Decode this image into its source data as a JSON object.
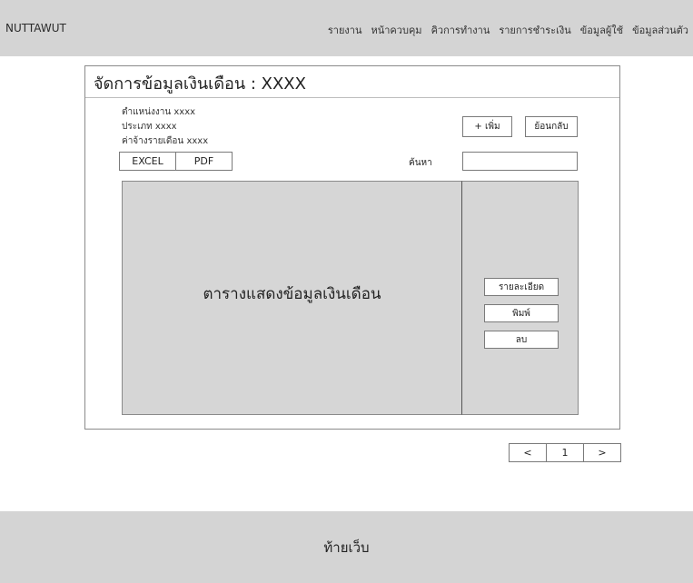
{
  "header": {
    "brand": "NUTTAWUT",
    "nav": [
      "รายงาน",
      "หน้าควบคุม",
      "คิวการทำงาน",
      "รายการชำระเงิน",
      "ข้อมูลผู้ใช้",
      "ข้อมูลส่วนตัว"
    ]
  },
  "panel": {
    "title": "จัดการข้อมูลเงินเดือน : XXXX",
    "info": {
      "position": "ตำแหน่งงาน xxxx",
      "type": "ประเภท xxxx",
      "wage": "ค่าจ้างรายเดือน xxxx"
    },
    "export": {
      "excel": "EXCEL",
      "pdf": "PDF"
    },
    "add_button": "+ เพิ่ม",
    "back_button": "ย้อนกลับ",
    "search_label": "ค้นหา",
    "search_value": "",
    "table_placeholder": "ตารางแสดงข้อมูลเงินเดือน",
    "side_actions": {
      "detail": "รายละเอียด",
      "print": "พิมพ์",
      "delete": "ลบ"
    }
  },
  "pagination": {
    "prev": "<",
    "page": "1",
    "next": ">"
  },
  "footer": {
    "text": "ท้ายเว็บ"
  }
}
